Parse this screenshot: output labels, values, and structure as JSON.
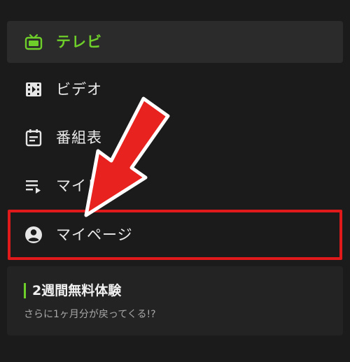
{
  "menu": {
    "items": [
      {
        "label": "テレビ",
        "icon": "tv-icon",
        "active": true
      },
      {
        "label": "ビデオ",
        "icon": "video-icon",
        "active": false
      },
      {
        "label": "番組表",
        "icon": "calendar-icon",
        "active": false
      },
      {
        "label": "マイリスト",
        "icon": "playlist-icon",
        "active": false
      },
      {
        "label": "マイページ",
        "icon": "account-icon",
        "active": false
      }
    ]
  },
  "trial": {
    "title": "2週間無料体験",
    "subtitle": "さらに1ヶ月分が戻ってくる!?"
  },
  "colors": {
    "accent_green": "#6fcf2a",
    "annotation_red": "#e01a1a",
    "background": "#1b1b1b"
  }
}
